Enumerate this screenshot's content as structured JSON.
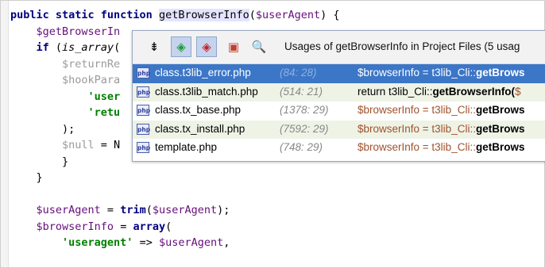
{
  "code_lines": [
    {
      "segs": [
        {
          "t": "public static function ",
          "c": "kw"
        },
        {
          "t": "getBrowserInfo",
          "c": "fn-hl"
        },
        {
          "t": "(",
          "c": ""
        },
        {
          "t": "$userAgent",
          "c": "var"
        },
        {
          "t": ") {",
          "c": ""
        }
      ]
    },
    {
      "segs": [
        {
          "t": "    ",
          "c": ""
        },
        {
          "t": "$getBrowserIn",
          "c": "var"
        }
      ]
    },
    {
      "segs": [
        {
          "t": "    ",
          "c": ""
        },
        {
          "t": "if",
          "c": "kw"
        },
        {
          "t": " (",
          "c": ""
        },
        {
          "t": "is_array",
          "c": "ital"
        },
        {
          "t": "(",
          "c": ""
        }
      ]
    },
    {
      "segs": [
        {
          "t": "        ",
          "c": ""
        },
        {
          "t": "$returnRe",
          "c": "fade"
        }
      ]
    },
    {
      "segs": [
        {
          "t": "        ",
          "c": ""
        },
        {
          "t": "$hookPara",
          "c": "fade"
        }
      ]
    },
    {
      "segs": [
        {
          "t": "            ",
          "c": ""
        },
        {
          "t": "'user",
          "c": "str"
        }
      ]
    },
    {
      "segs": [
        {
          "t": "            ",
          "c": ""
        },
        {
          "t": "'retu",
          "c": "str"
        }
      ]
    },
    {
      "segs": [
        {
          "t": "        );",
          "c": ""
        }
      ]
    },
    {
      "segs": [
        {
          "t": "        ",
          "c": ""
        },
        {
          "t": "$null",
          "c": "fade"
        },
        {
          "t": " = N",
          "c": ""
        }
      ]
    },
    {
      "segs": [
        {
          "t": "        }",
          "c": ""
        }
      ]
    },
    {
      "segs": [
        {
          "t": "    }",
          "c": ""
        }
      ]
    },
    {
      "segs": [
        {
          "t": "",
          "c": ""
        }
      ]
    },
    {
      "segs": [
        {
          "t": "    ",
          "c": ""
        },
        {
          "t": "$userAgent",
          "c": "var"
        },
        {
          "t": " = ",
          "c": ""
        },
        {
          "t": "trim",
          "c": "kw"
        },
        {
          "t": "(",
          "c": ""
        },
        {
          "t": "$userAgent",
          "c": "var"
        },
        {
          "t": ");",
          "c": ""
        }
      ]
    },
    {
      "segs": [
        {
          "t": "    ",
          "c": ""
        },
        {
          "t": "$browserInfo",
          "c": "var"
        },
        {
          "t": " = ",
          "c": ""
        },
        {
          "t": "array",
          "c": "kw"
        },
        {
          "t": "(",
          "c": ""
        }
      ]
    },
    {
      "segs": [
        {
          "t": "        ",
          "c": ""
        },
        {
          "t": "'useragent'",
          "c": "str"
        },
        {
          "t": " => ",
          "c": ""
        },
        {
          "t": "$userAgent",
          "c": "var"
        },
        {
          "t": ",",
          "c": ""
        }
      ]
    }
  ],
  "popup": {
    "title": "Usages of getBrowserInfo in Project Files (5 usag",
    "toolbar_icons": [
      "collapse-icon",
      "next-usage-icon",
      "prev-usage-icon",
      "pin-icon",
      "find-icon"
    ],
    "file_type_label": "php",
    "rows": [
      {
        "file": "class.t3lib_error.php",
        "loc": "(84: 28)",
        "pre": "$browserInfo = t3lib_Cli::",
        "bold": "getBrows",
        "selected": true
      },
      {
        "file": "class.t3lib_match.php",
        "loc": "(514: 21)",
        "pre": "return t3lib_Cli::",
        "bold": "getBrowserInfo(",
        "post": "$",
        "selected": false
      },
      {
        "file": "class.tx_base.php",
        "loc": "(1378: 29)",
        "pre": "$browserInfo = t3lib_Cli::",
        "bold": "getBrows",
        "selected": false
      },
      {
        "file": "class.tx_install.php",
        "loc": "(7592: 29)",
        "pre": "$browserInfo = t3lib_Cli::",
        "bold": "getBrows",
        "selected": false
      },
      {
        "file": "template.php",
        "loc": "(748: 29)",
        "pre": "$browserInfo = t3lib_Cli::",
        "bold": "getBrows",
        "selected": false
      }
    ]
  },
  "colors": {
    "selection": "#3c76c7",
    "keyword": "#000080",
    "variable": "#660e7a",
    "string": "#008000"
  }
}
